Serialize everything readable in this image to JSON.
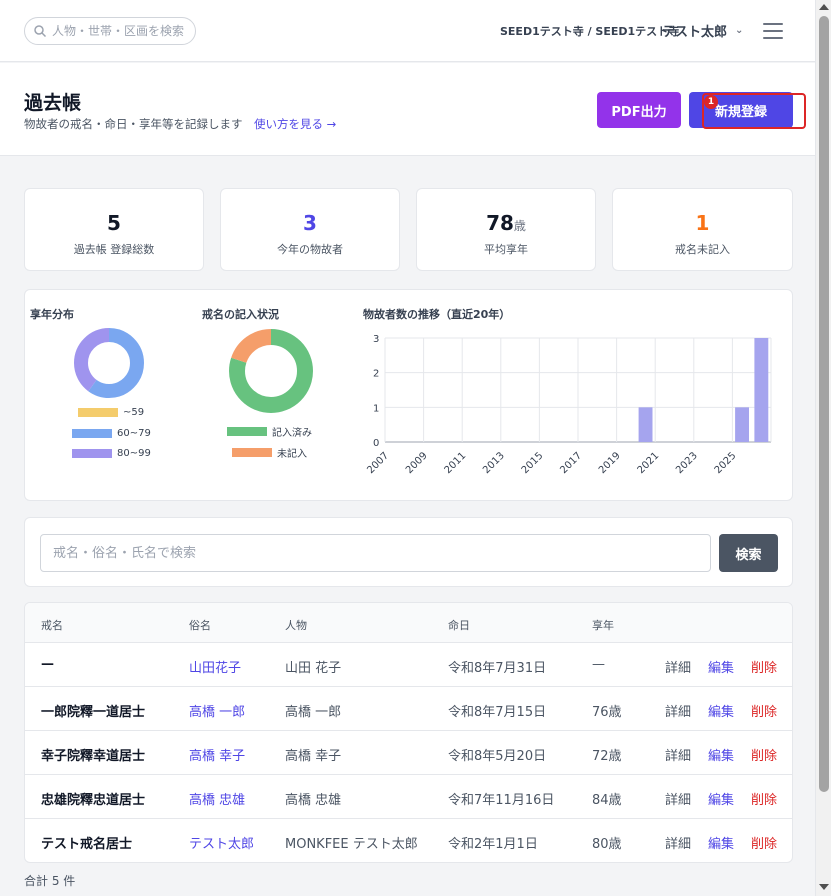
{
  "topbar": {
    "search_placeholder": "人物・世帯・区画を検索",
    "tenant": "SEED1テスト寺 / SEED1テスト寺",
    "user_name": "テスト太郎"
  },
  "header": {
    "title": "過去帳",
    "subtitle": "物故者の戒名・命日・享年等を記録します",
    "help_link": "使い方を見る →",
    "pdf_button": "PDF出力",
    "new_button": "新規登録",
    "highlight_badge": "1"
  },
  "stats": [
    {
      "value": "5",
      "unit": "",
      "label": "過去帳 登録総数",
      "color": "#111827"
    },
    {
      "value": "3",
      "unit": "",
      "label": "今年の物故者",
      "color": "#4f46e5"
    },
    {
      "value": "78",
      "unit": "歳",
      "label": "平均享年",
      "color": "#111827"
    },
    {
      "value": "1",
      "unit": "",
      "label": "戒名未記入",
      "color": "#f97316"
    }
  ],
  "chart_data": [
    {
      "type": "pie",
      "title": "享年分布",
      "categories": [
        "~59",
        "60~79",
        "80~99"
      ],
      "values": [
        0,
        3,
        2
      ],
      "colors": [
        "#f4cc6c",
        "#7aa7f0",
        "#9f94ee"
      ],
      "donut": true
    },
    {
      "type": "pie",
      "title": "戒名の記入状況",
      "categories": [
        "記入済み",
        "未記入"
      ],
      "values": [
        4,
        1
      ],
      "colors": [
        "#67c27f",
        "#f59e6a"
      ],
      "donut": true
    },
    {
      "type": "bar",
      "title": "物故者数の推移（直近20年）",
      "x": [
        2007,
        2008,
        2009,
        2010,
        2011,
        2012,
        2013,
        2014,
        2015,
        2016,
        2017,
        2018,
        2019,
        2020,
        2021,
        2022,
        2023,
        2024,
        2025,
        2026
      ],
      "values": [
        0,
        0,
        0,
        0,
        0,
        0,
        0,
        0,
        0,
        0,
        0,
        0,
        0,
        1,
        0,
        0,
        0,
        0,
        1,
        3
      ],
      "x_tick_labels": [
        "2007",
        "2009",
        "2011",
        "2013",
        "2015",
        "2017",
        "2019",
        "2021",
        "2023",
        "2025"
      ],
      "y_ticks": [
        "0",
        "1",
        "2",
        "3"
      ],
      "ylim": [
        0,
        3
      ],
      "grid": true,
      "color": "#a5a4ee"
    }
  ],
  "search": {
    "placeholder": "戒名・俗名・氏名で検索",
    "button": "検索"
  },
  "table": {
    "headers": [
      "戒名",
      "俗名",
      "人物",
      "命日",
      "享年"
    ],
    "actions": {
      "detail": "詳細",
      "edit": "編集",
      "delete": "削除"
    },
    "rows": [
      {
        "kaimyo": "—",
        "zokumyo": "山田花子",
        "person": "山田 花子",
        "date": "令和8年7月31日",
        "age": "—"
      },
      {
        "kaimyo": "一郎院釋一道居士",
        "zokumyo": "高橋 一郎",
        "person": "高橋 一郎",
        "date": "令和8年7月15日",
        "age": "76歳"
      },
      {
        "kaimyo": "幸子院釋幸道居士",
        "zokumyo": "高橋 幸子",
        "person": "高橋 幸子",
        "date": "令和8年5月20日",
        "age": "72歳"
      },
      {
        "kaimyo": "忠雄院釋忠道居士",
        "zokumyo": "高橋 忠雄",
        "person": "高橋 忠雄",
        "date": "令和7年11月16日",
        "age": "84歳"
      },
      {
        "kaimyo": "テスト戒名居士",
        "zokumyo": "テスト太郎",
        "person": "MONKFEE テスト太郎",
        "date": "令和2年1月1日",
        "age": "80歳"
      }
    ],
    "footer": "合計 5 件"
  }
}
